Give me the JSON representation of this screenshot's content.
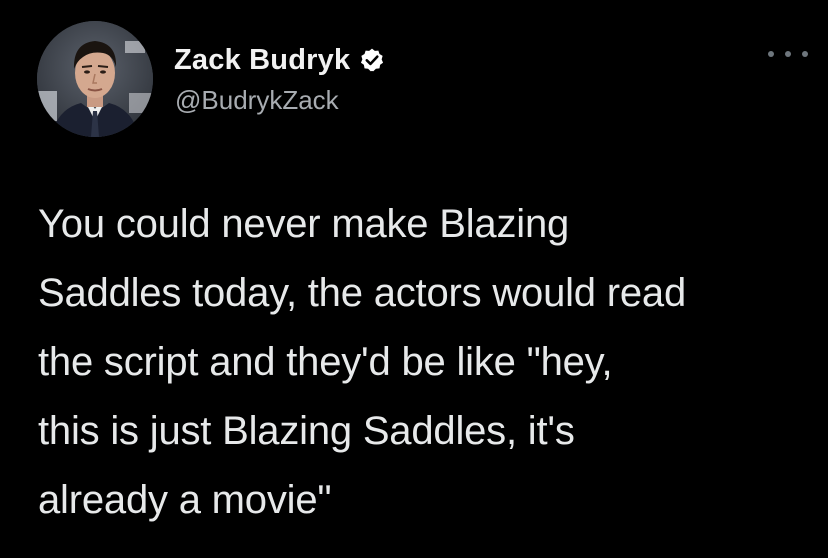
{
  "author": {
    "display_name": "Zack Budryk",
    "handle": "@BudrykZack",
    "verified": true,
    "avatar_icon": "profile-photo"
  },
  "tweet": {
    "text": "You could never make Blazing\nSaddles today, the actors would read\nthe script and they'd be like \"hey,\nthis is just Blazing Saddles, it's\nalready a movie\""
  },
  "menu_icon": "more-options-icon",
  "colors": {
    "background": "#000000",
    "text": "#e7e9ea",
    "handle": "#a8acb1",
    "verified_badge": "#ffffff"
  }
}
